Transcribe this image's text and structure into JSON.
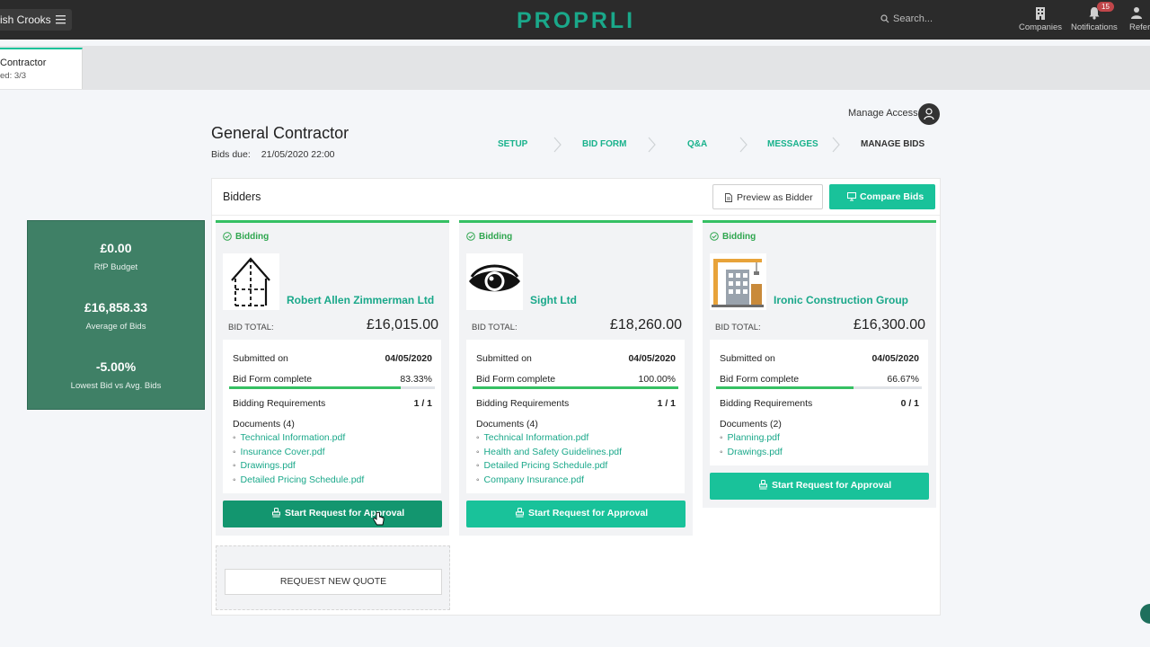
{
  "topbar": {
    "project_name": "rish Crooks",
    "logo": "PROPRLI",
    "search_placeholder": "Search...",
    "nav": [
      {
        "label": "Companies",
        "icon": "building-icon"
      },
      {
        "label": "Notifications",
        "icon": "bell-icon",
        "badge": "15"
      },
      {
        "label": "Refer",
        "icon": "user-icon"
      }
    ]
  },
  "active_tab": {
    "title": "Contractor",
    "subtitle": "ed: 3/3"
  },
  "header": {
    "manage_access": "Manage Access",
    "title": "General Contractor",
    "bids_due_label": "Bids due:",
    "bids_due_value": "21/05/2020 22:00"
  },
  "steps": [
    "SETUP",
    "BID FORM",
    "Q&A",
    "MESSAGES",
    "MANAGE BIDS"
  ],
  "panel": {
    "title": "Bidders",
    "preview_label": "Preview as Bidder",
    "compare_label": "Compare Bids"
  },
  "summary": [
    {
      "value": "£0.00",
      "label": "RfP Budget"
    },
    {
      "value": "£16,858.33",
      "label": "Average of Bids"
    },
    {
      "value": "-5.00%",
      "label": "Lowest Bid vs Avg. Bids"
    }
  ],
  "labels": {
    "bid_total": "BID TOTAL:",
    "submitted_on": "Submitted on",
    "bid_form_complete": "Bid Form complete",
    "bidding_requirements": "Bidding Requirements",
    "approval": "Start Request for Approval",
    "request_quote": "REQUEST NEW QUOTE"
  },
  "bidders": [
    {
      "status": "Bidding",
      "company": "Robert Allen Zimmerman Ltd",
      "logo": "house-outline-logo",
      "bid_total": "£16,015.00",
      "submitted_on": "04/05/2020",
      "bid_form_complete": "83.33%",
      "bid_form_fraction": 0.8333,
      "requirements": "1 / 1",
      "documents_label": "Documents (4)",
      "documents": [
        "Technical Information.pdf",
        "Insurance Cover.pdf",
        "Drawings.pdf",
        "Detailed Pricing Schedule.pdf"
      ]
    },
    {
      "status": "Bidding",
      "company": "Sight Ltd",
      "logo": "eye-logo",
      "bid_total": "£18,260.00",
      "submitted_on": "04/05/2020",
      "bid_form_complete": "100.00%",
      "bid_form_fraction": 1.0,
      "requirements": "1 / 1",
      "documents_label": "Documents (4)",
      "documents": [
        "Technical Information.pdf",
        "Health and Safety Guidelines.pdf",
        "Detailed Pricing Schedule.pdf",
        "Company Insurance.pdf"
      ]
    },
    {
      "status": "Bidding",
      "company": "Ironic Construction Group",
      "logo": "crane-building-logo",
      "bid_total": "£16,300.00",
      "submitted_on": "04/05/2020",
      "bid_form_complete": "66.67%",
      "bid_form_fraction": 0.6667,
      "requirements": "0 / 1",
      "documents_label": "Documents (2)",
      "documents": [
        "Planning.pdf",
        "Drawings.pdf"
      ]
    }
  ],
  "colors": {
    "accent": "#19c29a",
    "link": "#1aa88a",
    "status_green": "#36c063",
    "summary_bg": "#3f8066",
    "topbar": "#2b2b2b"
  }
}
